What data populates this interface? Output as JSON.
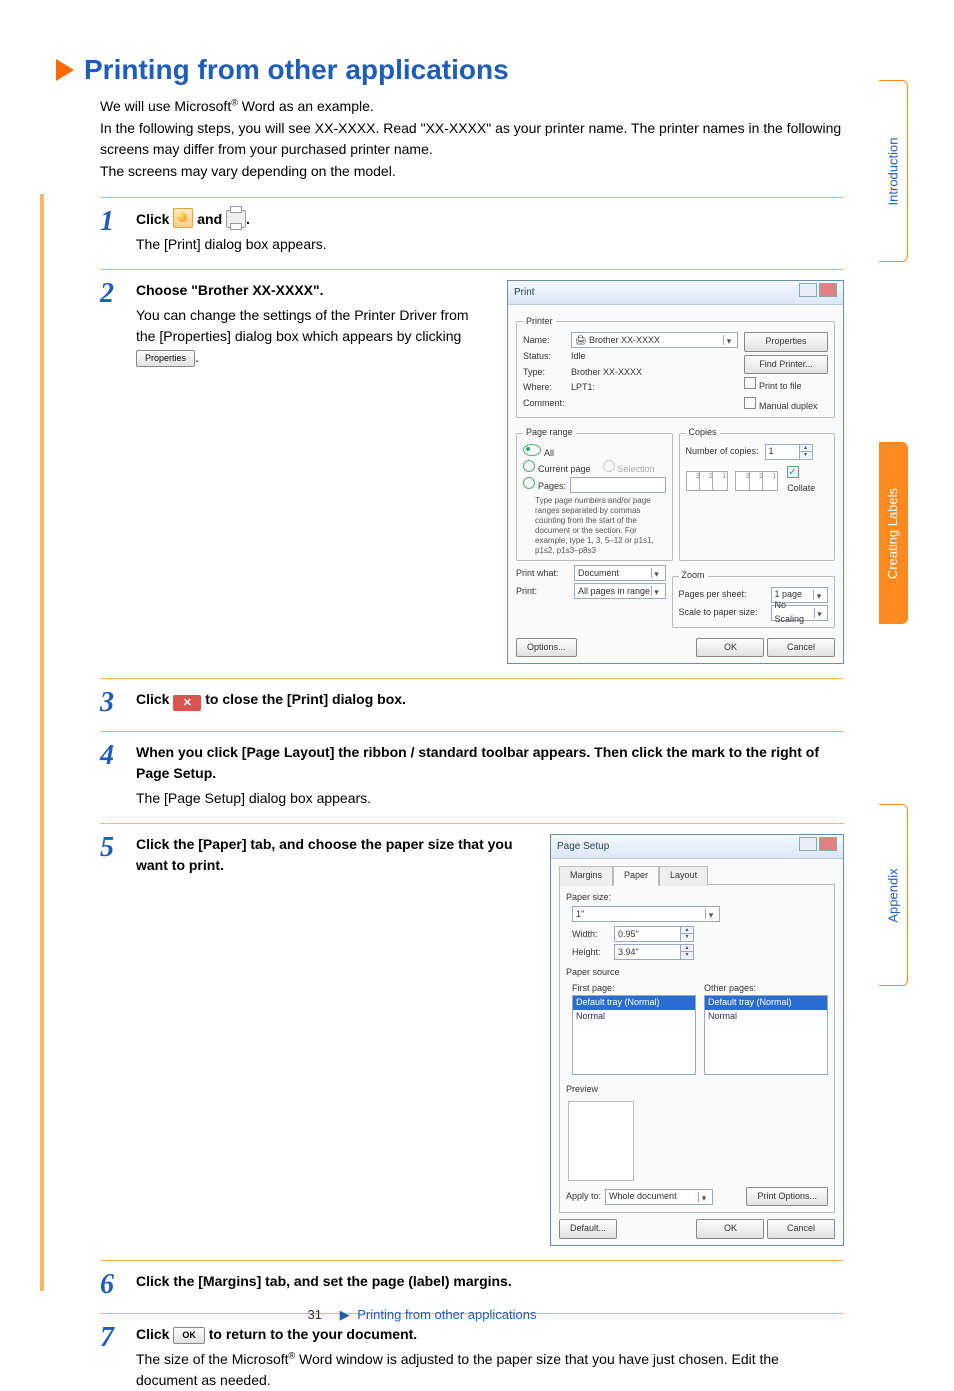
{
  "document": {
    "heading": "Printing from other applications",
    "intro_line1_a": "We will use Microsoft",
    "intro_line1_b": " Word as an example.",
    "intro_line2": "In the following steps, you will see XX-XXXX. Read \"XX-XXXX\" as your printer name. The printer names in the following screens may differ from your purchased printer name.",
    "intro_line3": "The screens may vary depending on the model.",
    "reg": "®"
  },
  "side_tabs": {
    "tab1": "Introduction",
    "tab2": "Creating Labels",
    "tab3": "Appendix"
  },
  "steps": {
    "s1": {
      "n": "1",
      "lead_a": "Click ",
      "lead_b": " and ",
      "lead_c": ".",
      "sub": "The [Print] dialog box appears."
    },
    "s2": {
      "n": "2",
      "lead": "Choose \"Brother XX-XXXX\".",
      "sub_a": "You can change the settings of the Printer Driver from the [Properties] dialog box which appears by clicking ",
      "sub_c": ".",
      "btn": "Properties"
    },
    "s3": {
      "n": "3",
      "lead_a": "Click ",
      "lead_b": " to close the [Print] dialog box."
    },
    "s4": {
      "n": "4",
      "lead": "When you click [Page Layout] the ribbon / standard toolbar appears. Then click the mark to the right of Page Setup.",
      "sub": "The [Page Setup] dialog box appears."
    },
    "s5": {
      "n": "5",
      "lead": "Click the [Paper] tab, and choose the paper size that you want to print."
    },
    "s6": {
      "n": "6",
      "lead": "Click the [Margins] tab, and set the page (label) margins."
    },
    "s7": {
      "n": "7",
      "lead_a": "Click ",
      "lead_b": " to return to the your document.",
      "btn": "OK",
      "sub_a": "The size of the Microsoft",
      "sub_b": " Word window is adjusted to the paper size that you have just chosen. Edit the document as needed."
    }
  },
  "print_dialog": {
    "title": "Print",
    "grp_printer": "Printer",
    "lbl_name": "Name:",
    "val_name": "Brother XX-XXXX",
    "btn_properties": "Properties",
    "lbl_status": "Status:",
    "val_status": "Idle",
    "btn_find": "Find Printer...",
    "lbl_type": "Type:",
    "val_type": "Brother XX-XXXX",
    "chk_file": "Print to file",
    "lbl_where": "Where:",
    "val_where": "LPT1:",
    "chk_duplex": "Manual duplex",
    "lbl_comment": "Comment:",
    "grp_range": "Page range",
    "opt_all": "All",
    "opt_current": "Current page",
    "opt_selection": "Selection",
    "opt_pages": "Pages:",
    "range_hint": "Type page numbers and/or page ranges separated by commas counting from the start of the document or the section. For example, type 1, 3, 5–12 or p1s1, p1s2, p1s3–p8s3",
    "grp_copies": "Copies",
    "lbl_numcopies": "Number of copies:",
    "val_numcopies": "1",
    "chk_collate": "Collate",
    "lbl_printwhat": "Print what:",
    "val_printwhat": "Document",
    "lbl_print": "Print:",
    "val_print": "All pages in range",
    "grp_zoom": "Zoom",
    "lbl_pps": "Pages per sheet:",
    "val_pps": "1 page",
    "lbl_scale": "Scale to paper size:",
    "val_scale": "No Scaling",
    "btn_options": "Options...",
    "btn_ok": "OK",
    "btn_cancel": "Cancel"
  },
  "page_setup_dialog": {
    "title": "Page Setup",
    "tab_margins": "Margins",
    "tab_paper": "Paper",
    "tab_layout": "Layout",
    "lbl_papersize": "Paper size:",
    "val_papersize": "1\"",
    "lbl_width": "Width:",
    "val_width": "0.95\"",
    "lbl_height": "Height:",
    "val_height": "3.94\"",
    "lbl_papersource": "Paper source",
    "lbl_firstpage": "First page:",
    "lbl_otherpages": "Other pages:",
    "opt_default": "Default tray (Normal)",
    "opt_normal": "Normal",
    "lbl_preview": "Preview",
    "lbl_applyto": "Apply to:",
    "val_applyto": "Whole document",
    "btn_printoptions": "Print Options...",
    "btn_default": "Default...",
    "btn_ok": "OK",
    "btn_cancel": "Cancel"
  },
  "footer": {
    "page": "31",
    "arrow": "▶",
    "link": "Printing from other applications"
  }
}
